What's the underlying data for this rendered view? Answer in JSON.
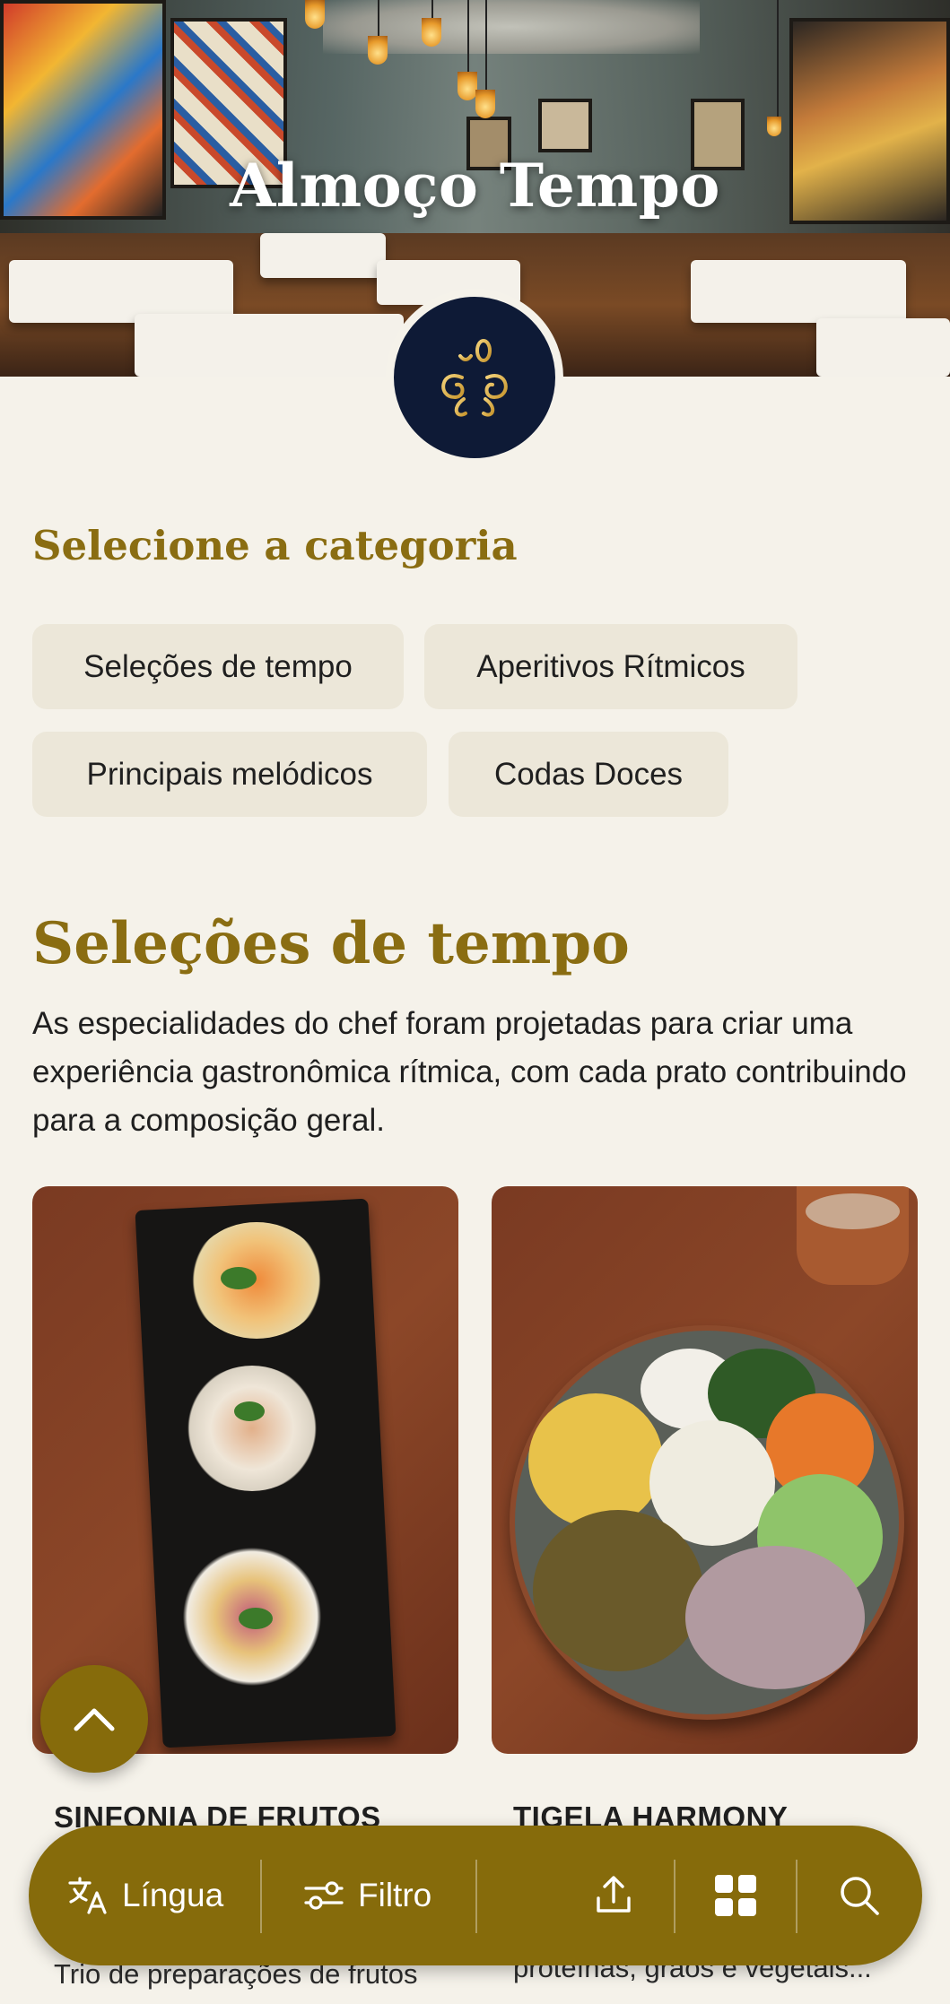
{
  "hero": {
    "title": "Almoço Tempo",
    "logo_icon": "fork-spoon-logo-icon"
  },
  "categories": {
    "heading": "Selecione a categoria",
    "items": [
      {
        "label": "Seleções de tempo"
      },
      {
        "label": "Aperitivos Rítmicos"
      },
      {
        "label": "Principais melódicos"
      },
      {
        "label": "Codas Doces"
      }
    ]
  },
  "section": {
    "title": "Seleções de tempo",
    "description": "As especialidades do chef foram projetadas para criar uma experiência gastronômica rítmica, com cada prato contribuindo para a composição geral."
  },
  "dishes": [
    {
      "name": "SINFONIA DE FRUTOS",
      "description": "Trio de preparações de frutos"
    },
    {
      "name": "TIGELA HARMONY",
      "description": "proteínas, grãos e vegetais..."
    }
  ],
  "bottom_bar": {
    "language_label": "Língua",
    "filter_label": "Filtro",
    "icons": [
      "translate-icon",
      "filter-icon",
      "share-icon",
      "grid-icon",
      "search-icon"
    ]
  },
  "colors": {
    "accent": "#866b0b",
    "heading_gold": "#8a6d12",
    "background": "#f5f2ea",
    "chip_bg": "#ece7d9",
    "logo_bg": "#0e1a36"
  }
}
